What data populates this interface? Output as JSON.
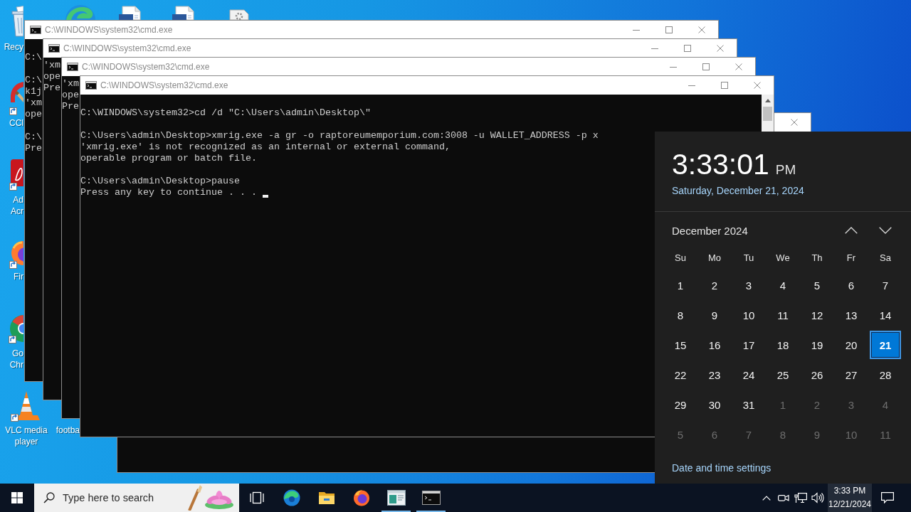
{
  "desktop_icons": [
    {
      "kind": "bin",
      "label": "Recy"
    },
    {
      "kind": "swirl"
    },
    {
      "kind": "doc"
    },
    {
      "kind": "doc"
    },
    {
      "kind": "gear"
    },
    {
      "kind": "brush",
      "label": "CCl"
    },
    {
      "kind": "tile",
      "label": "Ad Acr"
    },
    {
      "kind": "fox",
      "label": "Fir"
    },
    {
      "kind": "wheel",
      "label": "Go Chr"
    },
    {
      "kind": "cone",
      "label": "VLC media player"
    },
    {
      "label": "footba"
    }
  ],
  "windows": [
    {
      "controls": [
        {
          "kind": "close"
        }
      ]
    },
    {
      "title": "C:\\WINDOWS\\system32\\cmd.exe",
      "controls": [
        {
          "kind": "minimize"
        },
        {
          "kind": "maximize"
        },
        {
          "kind": "close"
        }
      ],
      "blocks": [
        [
          "C:\\"
        ],
        [
          "C:\\",
          "k1j",
          "'xm",
          "ope"
        ],
        [
          "C:\\",
          "Pre"
        ]
      ]
    },
    {
      "title": "C:\\WINDOWS\\system32\\cmd.exe",
      "controls": [
        {
          "kind": "minimize"
        },
        {
          "kind": "maximize"
        },
        {
          "kind": "close"
        }
      ],
      "blocks": [
        [
          "'xm",
          "ope",
          "Pre"
        ]
      ]
    },
    {
      "title": "C:\\WINDOWS\\system32\\cmd.exe",
      "controls": [
        {
          "kind": "minimize"
        },
        {
          "kind": "maximize"
        },
        {
          "kind": "close"
        }
      ],
      "blocks": [
        [
          "'xm",
          "ope",
          "Pre"
        ]
      ]
    },
    {
      "title": "C:\\WINDOWS\\system32\\cmd.exe",
      "controls": [
        {
          "kind": "minimize"
        },
        {
          "kind": "maximize"
        },
        {
          "kind": "close"
        }
      ],
      "blocks": [
        [
          "C:\\WINDOWS\\system32>cd /d \"C:\\Users\\admin\\Desktop\\\""
        ],
        [
          "C:\\Users\\admin\\Desktop>xmrig.exe -a gr -o raptoreumemporium.com:3008 -u WALLET_ADDRESS -p x",
          "'xmrig.exe' is not recognized as an internal or external command,",
          "operable program or batch file."
        ],
        [
          "C:\\Users\\admin\\Desktop>pause",
          "Press any key to continue . . ."
        ]
      ],
      "cursor": true
    }
  ],
  "calendar": {
    "time": "3:33:01",
    "period": "PM",
    "date": "Saturday, December 21, 2024",
    "month": "December 2024",
    "weekdays": [
      "Su",
      "Mo",
      "Tu",
      "We",
      "Th",
      "Fr",
      "Sa"
    ],
    "weeks": [
      [
        {
          "day": "1",
          "in_month": true,
          "selected": false
        },
        {
          "day": "2",
          "in_month": true,
          "selected": false
        },
        {
          "day": "3",
          "in_month": true,
          "selected": false
        },
        {
          "day": "4",
          "in_month": true,
          "selected": false
        },
        {
          "day": "5",
          "in_month": true,
          "selected": false
        },
        {
          "day": "6",
          "in_month": true,
          "selected": false
        },
        {
          "day": "7",
          "in_month": true,
          "selected": false
        }
      ],
      [
        {
          "day": "8",
          "in_month": true,
          "selected": false
        },
        {
          "day": "9",
          "in_month": true,
          "selected": false
        },
        {
          "day": "10",
          "in_month": true,
          "selected": false
        },
        {
          "day": "11",
          "in_month": true,
          "selected": false
        },
        {
          "day": "12",
          "in_month": true,
          "selected": false
        },
        {
          "day": "13",
          "in_month": true,
          "selected": false
        },
        {
          "day": "14",
          "in_month": true,
          "selected": false
        }
      ],
      [
        {
          "day": "15",
          "in_month": true,
          "selected": false
        },
        {
          "day": "16",
          "in_month": true,
          "selected": false
        },
        {
          "day": "17",
          "in_month": true,
          "selected": false
        },
        {
          "day": "18",
          "in_month": true,
          "selected": false
        },
        {
          "day": "19",
          "in_month": true,
          "selected": false
        },
        {
          "day": "20",
          "in_month": true,
          "selected": false
        },
        {
          "day": "21",
          "in_month": true,
          "selected": true
        }
      ],
      [
        {
          "day": "22",
          "in_month": true,
          "selected": false
        },
        {
          "day": "23",
          "in_month": true,
          "selected": false
        },
        {
          "day": "24",
          "in_month": true,
          "selected": false
        },
        {
          "day": "25",
          "in_month": true,
          "selected": false
        },
        {
          "day": "26",
          "in_month": true,
          "selected": false
        },
        {
          "day": "27",
          "in_month": true,
          "selected": false
        },
        {
          "day": "28",
          "in_month": true,
          "selected": false
        }
      ],
      [
        {
          "day": "29",
          "in_month": true,
          "selected": false
        },
        {
          "day": "30",
          "in_month": true,
          "selected": false
        },
        {
          "day": "31",
          "in_month": true,
          "selected": false
        },
        {
          "day": "1",
          "in_month": false,
          "selected": false
        },
        {
          "day": "2",
          "in_month": false,
          "selected": false
        },
        {
          "day": "3",
          "in_month": false,
          "selected": false
        },
        {
          "day": "4",
          "in_month": false,
          "selected": false
        }
      ],
      [
        {
          "day": "5",
          "in_month": false,
          "selected": false
        },
        {
          "day": "6",
          "in_month": false,
          "selected": false
        },
        {
          "day": "7",
          "in_month": false,
          "selected": false
        },
        {
          "day": "8",
          "in_month": false,
          "selected": false
        },
        {
          "day": "9",
          "in_month": false,
          "selected": false
        },
        {
          "day": "10",
          "in_month": false,
          "selected": false
        },
        {
          "day": "11",
          "in_month": false,
          "selected": false
        }
      ]
    ],
    "settings_link": "Date and time settings"
  },
  "taskbar": {
    "search": {
      "placeholder": "Type here to search"
    },
    "apps": [
      {
        "kind": "taskview",
        "running": false
      },
      {
        "kind": "swirl",
        "running": false
      },
      {
        "kind": "folder",
        "running": false
      },
      {
        "kind": "fox",
        "running": false
      },
      {
        "kind": "viewer",
        "running": true
      },
      {
        "kind": "console",
        "running": true
      }
    ],
    "clock": {
      "time": "3:33 PM",
      "date": "12/21/2024",
      "expanded": true
    }
  }
}
